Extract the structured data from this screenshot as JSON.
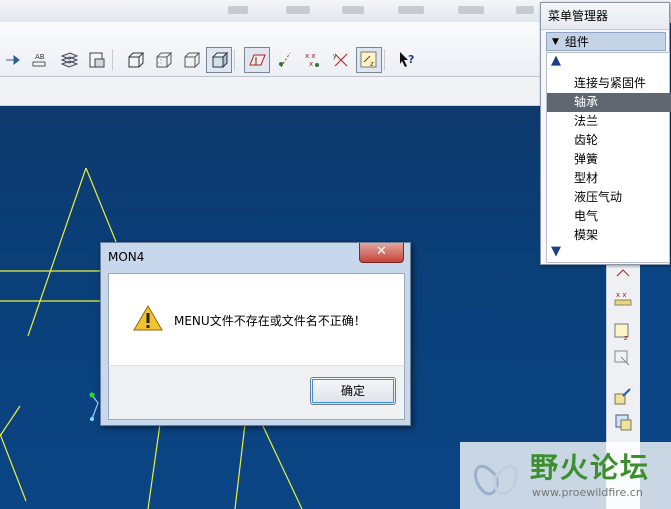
{
  "topbar": {
    "items": [
      "",
      "",
      "",
      "",
      "",
      ""
    ]
  },
  "toolbar": {
    "buttons": [
      "node-icon",
      "text-ab-icon",
      "layers-icon",
      "save-image-icon",
      "cube-wire-icon",
      "cube-hidden-icon",
      "cube-noline-icon",
      "cube-shaded-icon",
      "plane-display-icon",
      "axis-display-icon",
      "point-display-icon",
      "csys-display-icon",
      "csys-toggle-icon",
      "whats-this-icon"
    ]
  },
  "menu_manager": {
    "title": "菜单管理器",
    "group_label": "组件",
    "items": [
      "连接与紧固件",
      "轴承",
      "法兰",
      "齿轮",
      "弹簧",
      "型材",
      "液压气动",
      "电气",
      "模架"
    ],
    "selected_index": 1
  },
  "dialog": {
    "title": "MON4",
    "close_label": "✕",
    "message": "MENU文件不存在或文件名不正确！",
    "ok_label": "确定"
  },
  "watermark": {
    "title": "野火论坛",
    "url": "www.proewildfire.cn"
  },
  "colors": {
    "canvas_top": "#0e3a6e",
    "canvas_bottom": "#0b4585",
    "wire": "#e8f03a",
    "selection": "#5f6670"
  }
}
